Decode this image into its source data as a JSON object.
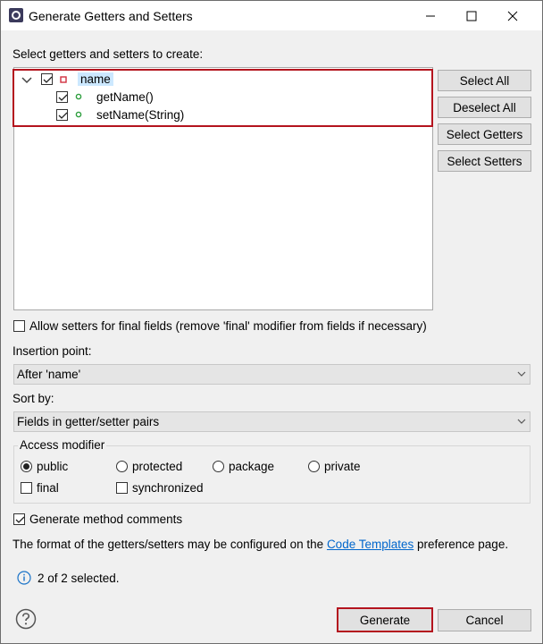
{
  "window": {
    "title": "Generate Getters and Setters",
    "minimize_icon": "minimize-icon",
    "maximize_icon": "maximize-icon",
    "close_icon": "close-icon"
  },
  "tree": {
    "label": "Select getters and setters to create:",
    "root": {
      "label": "name",
      "checked": true,
      "expanded": true
    },
    "children": [
      {
        "label": "getName()",
        "checked": true
      },
      {
        "label": "setName(String)",
        "checked": true
      }
    ]
  },
  "side_buttons": {
    "select_all": "Select All",
    "deselect_all": "Deselect All",
    "select_getters": "Select Getters",
    "select_setters": "Select Setters"
  },
  "allow_final": {
    "label": "Allow setters for final fields (remove 'final' modifier from fields if necessary)",
    "checked": false
  },
  "insertion": {
    "label": "Insertion point:",
    "value": "After 'name'"
  },
  "sort": {
    "label": "Sort by:",
    "value": "Fields in getter/setter pairs"
  },
  "access": {
    "label": "Access modifier",
    "options": [
      "public",
      "protected",
      "package",
      "private"
    ],
    "selected": "public",
    "final_label": "final",
    "synchronized_label": "synchronized"
  },
  "comments": {
    "label": "Generate method comments",
    "checked": true
  },
  "info": {
    "prefix": "The format of the getters/setters may be configured on the ",
    "link": "Code Templates",
    "suffix": " preference page."
  },
  "status": "2 of 2 selected.",
  "footer": {
    "generate": "Generate",
    "cancel": "Cancel"
  },
  "colors": {
    "highlight_border": "#b4141e",
    "field_icon": "#d12f3f",
    "method_icon": "#2e9e3e",
    "link": "#0066cc"
  }
}
